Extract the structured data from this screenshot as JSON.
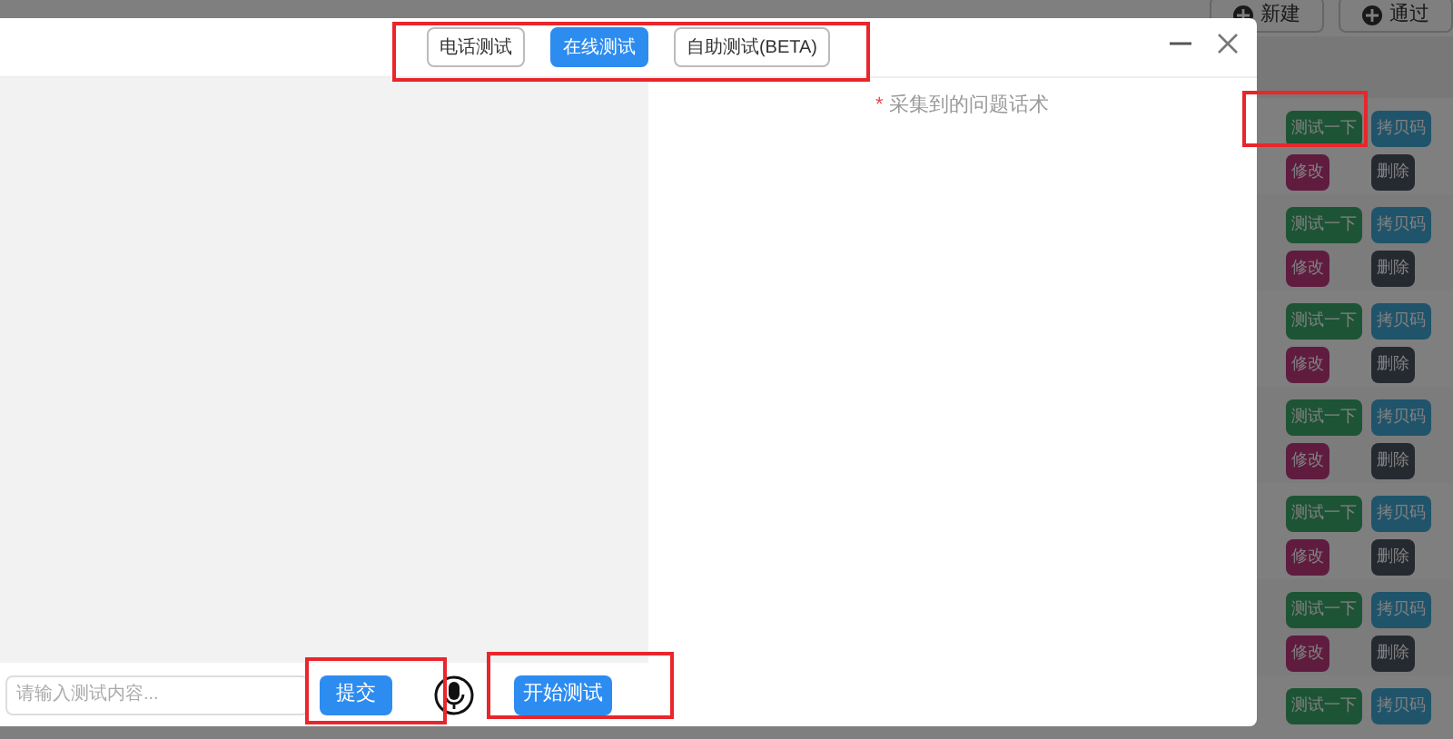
{
  "background": {
    "toolbar": [
      {
        "label": "新建"
      },
      {
        "label": "通过"
      }
    ],
    "rows": [
      {
        "buttons": [
          {
            "label": "测试一下",
            "kind": "test"
          },
          {
            "label": "拷贝码",
            "kind": "copy"
          },
          {
            "label": "修改",
            "kind": "edit"
          },
          {
            "label": "删除",
            "kind": "delete"
          }
        ]
      },
      {
        "buttons": [
          {
            "label": "测试一下",
            "kind": "test"
          },
          {
            "label": "拷贝码",
            "kind": "copy"
          },
          {
            "label": "修改",
            "kind": "edit"
          },
          {
            "label": "删除",
            "kind": "delete"
          }
        ]
      },
      {
        "buttons": [
          {
            "label": "测试一下",
            "kind": "test"
          },
          {
            "label": "拷贝码",
            "kind": "copy"
          },
          {
            "label": "修改",
            "kind": "edit"
          },
          {
            "label": "删除",
            "kind": "delete"
          }
        ]
      },
      {
        "buttons": [
          {
            "label": "测试一下",
            "kind": "test"
          },
          {
            "label": "拷贝码",
            "kind": "copy"
          },
          {
            "label": "修改",
            "kind": "edit"
          },
          {
            "label": "删除",
            "kind": "delete"
          }
        ]
      },
      {
        "buttons": [
          {
            "label": "测试一下",
            "kind": "test"
          },
          {
            "label": "拷贝码",
            "kind": "copy"
          },
          {
            "label": "修改",
            "kind": "edit"
          },
          {
            "label": "删除",
            "kind": "delete"
          }
        ]
      },
      {
        "buttons": [
          {
            "label": "测试一下",
            "kind": "test"
          },
          {
            "label": "拷贝码",
            "kind": "copy"
          },
          {
            "label": "修改",
            "kind": "edit"
          },
          {
            "label": "删除",
            "kind": "delete"
          }
        ]
      },
      {
        "buttons": [
          {
            "label": "测试一下",
            "kind": "test"
          },
          {
            "label": "拷贝码",
            "kind": "copy"
          }
        ]
      }
    ]
  },
  "dialog": {
    "tabs": [
      {
        "label": "电话测试",
        "selected": false
      },
      {
        "label": "在线测试",
        "selected": true
      },
      {
        "label": "自助测试(BETA)",
        "selected": false
      }
    ],
    "collected_label": {
      "required_mark": "*",
      "text": "采集到的问题话术"
    },
    "input": {
      "placeholder": "请输入测试内容..."
    },
    "submit_button": "提交",
    "start_button": "开始测试"
  }
}
